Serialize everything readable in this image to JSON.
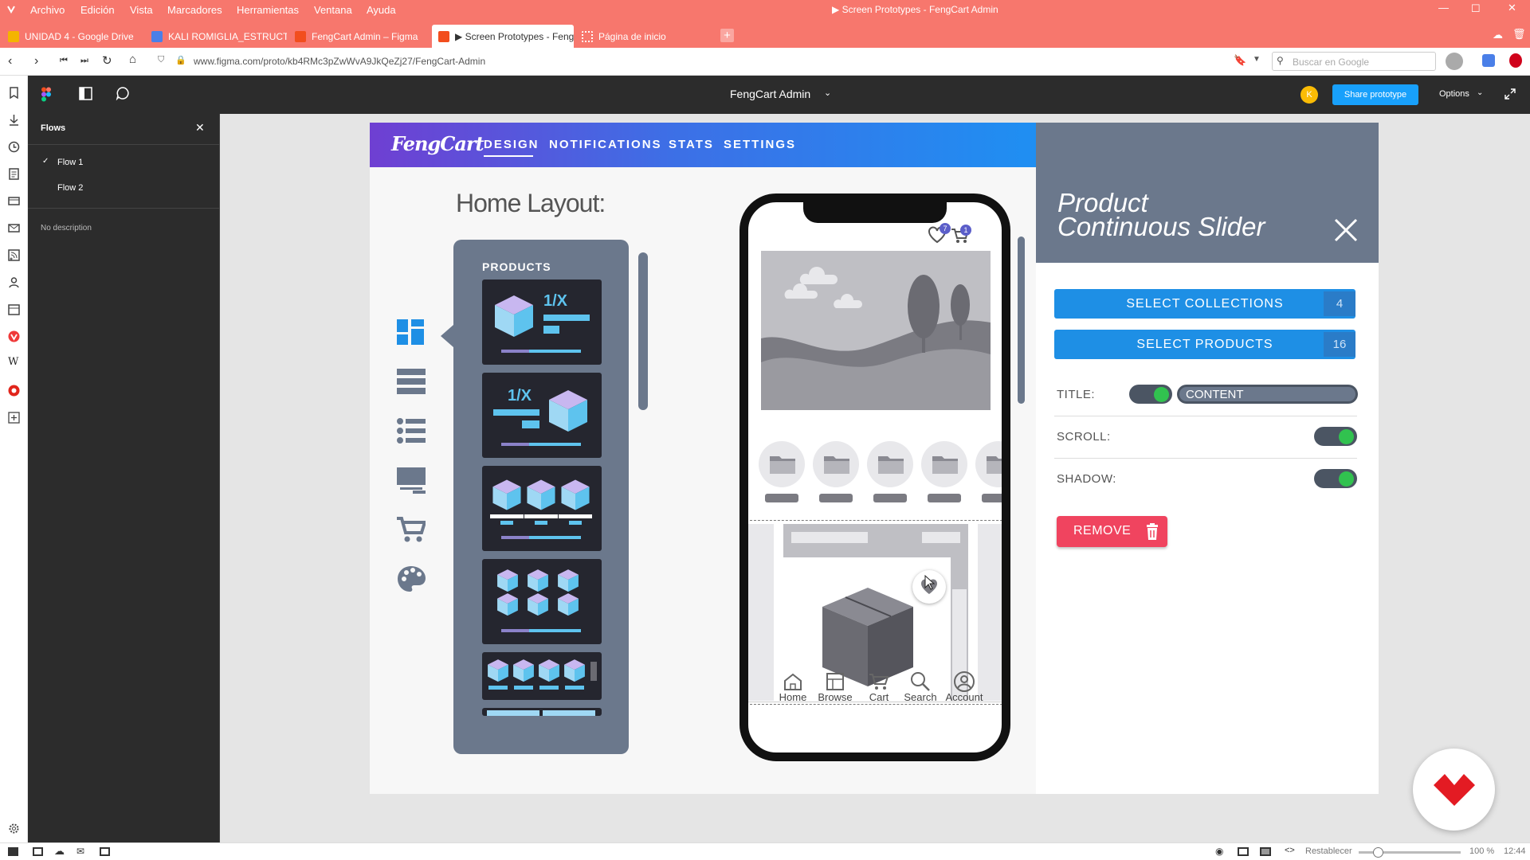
{
  "browser": {
    "menu": [
      "Archivo",
      "Edición",
      "Vista",
      "Marcadores",
      "Herramientas",
      "Ventana",
      "Ayuda"
    ],
    "window_title": "▶ Screen Prototypes - FengCart Admin",
    "tabs": [
      {
        "label": "UNIDAD 4 - Google Drive",
        "color": "#f4b400"
      },
      {
        "label": "KALI ROMIGLIA_ESTRUCTU",
        "color": "#4a7fe8"
      },
      {
        "label": "FengCart Admin – Figma",
        "color": "#f24e1e"
      },
      {
        "label": "▶ Screen Prototypes - Feng",
        "color": "#f24e1e"
      },
      {
        "label": "Página de inicio",
        "color": "#fff"
      }
    ],
    "url": "www.figma.com/proto/kb4RMc3pZwWvA9JkQeZj27/FengCart-Admin",
    "search_placeholder": "Buscar en Google",
    "status": {
      "restore": "Restablecer",
      "zoom": "100 %",
      "clock": "12:44"
    }
  },
  "figma": {
    "file_title": "FengCart Admin",
    "avatar_initial": "K",
    "share_label": "Share prototype",
    "options_label": "Options",
    "flows_title": "Flows",
    "flows": [
      "Flow 1",
      "Flow 2"
    ],
    "description": "No description"
  },
  "app": {
    "logo": "FengCart",
    "nav": [
      "DESIGN",
      "NOTIFICATIONS",
      "STATS",
      "SETTINGS"
    ],
    "heading": "Home Layout:",
    "products_label": "PRODUCTS",
    "thumb_label": "1/X",
    "phone": {
      "wishlist_count": "7",
      "cart_count": "1",
      "nav": [
        "Home",
        "Browse",
        "Cart",
        "Search",
        "Account"
      ]
    },
    "panel": {
      "title_line1": "Product",
      "title_line2": "Continuous Slider",
      "select_collections": "SELECT COLLECTIONS",
      "collections_count": "4",
      "select_products": "SELECT PRODUCTS",
      "products_count": "16",
      "title_label": "TITLE:",
      "content_label": "CONTENT",
      "scroll_label": "SCROLL:",
      "shadow_label": "SHADOW:",
      "remove_label": "REMOVE"
    }
  },
  "colors": {
    "browser": "#f7776d",
    "figma_dark": "#2c2c2c",
    "accent_blue": "#1e8fe5",
    "toggle_on": "#31c24f",
    "remove": "#f0445f"
  }
}
